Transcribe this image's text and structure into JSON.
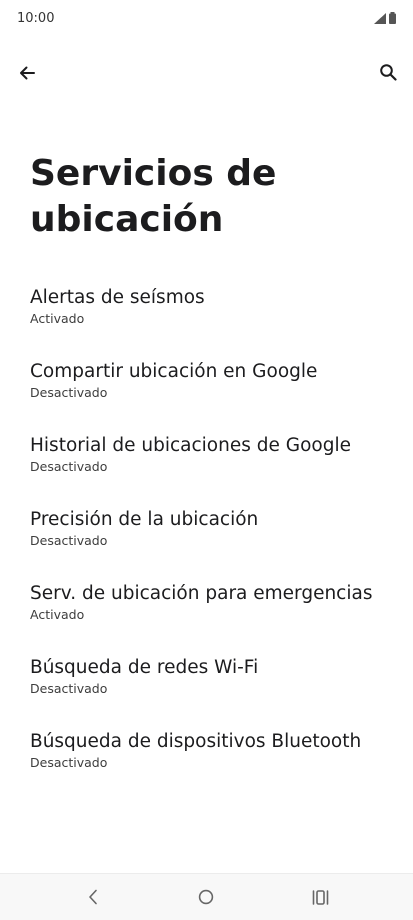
{
  "status_bar": {
    "time": "10:00"
  },
  "app_bar": {
    "back_icon": "arrow-back-icon",
    "search_icon": "search-icon"
  },
  "page": {
    "title": "Servicios de ubicación"
  },
  "settings": [
    {
      "title": "Alertas de seísmos",
      "status": "Activado"
    },
    {
      "title": "Compartir ubicación en Google",
      "status": "Desactivado"
    },
    {
      "title": "Historial de ubicaciones de Google",
      "status": "Desactivado"
    },
    {
      "title": "Precisión de la ubicación",
      "status": "Desactivado"
    },
    {
      "title": "Serv. de ubicación para emergencias",
      "status": "Activado"
    },
    {
      "title": "Búsqueda de redes Wi-Fi",
      "status": "Desactivado"
    },
    {
      "title": "Búsqueda de dispositivos Bluetooth",
      "status": "Desactivado"
    }
  ],
  "nav_bar": {
    "back": "nav-back-icon",
    "home": "home-icon",
    "recents": "recents-icon"
  }
}
